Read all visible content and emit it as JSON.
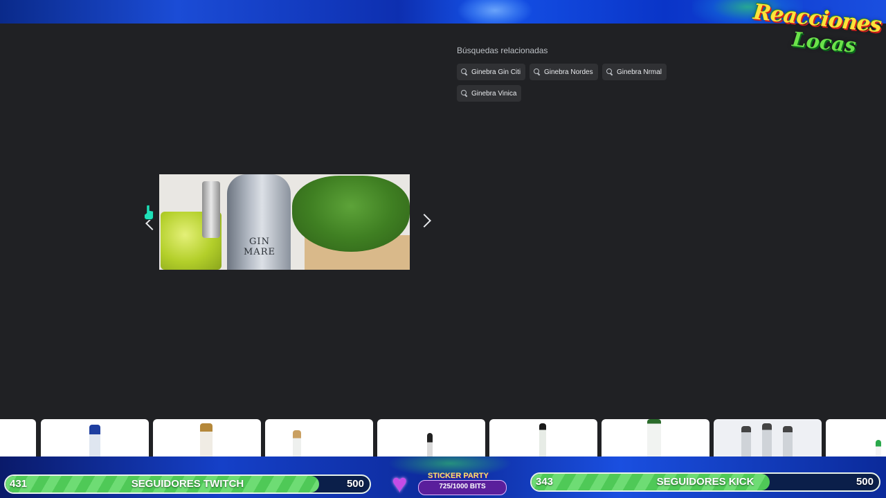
{
  "stream_overlay": {
    "logo_line1": "Reacciones",
    "logo_line2": "Locas",
    "twitch_goal": {
      "current": "431",
      "label": "SEGUIDORES TWITCH",
      "target": "500",
      "progress": 0.862
    },
    "kick_goal": {
      "current": "343",
      "label": "SEGUIDORES KICK",
      "target": "500",
      "progress": 0.686
    },
    "sticker_party": {
      "title": "STICKER PARTY",
      "progress_text": "725/1000 BITS"
    }
  },
  "related": {
    "title": "Búsquedas relacionadas",
    "chips": [
      "Ginebra Gin Citi",
      "Ginebra Nordes",
      "Ginebra Nrmal",
      "Ginebra Vinica"
    ]
  },
  "carousel": {
    "bottle_label": "GIN MARE"
  },
  "colors": {
    "background": "#202124",
    "chip_bg": "#303134",
    "goal_green": "#6edc74"
  }
}
